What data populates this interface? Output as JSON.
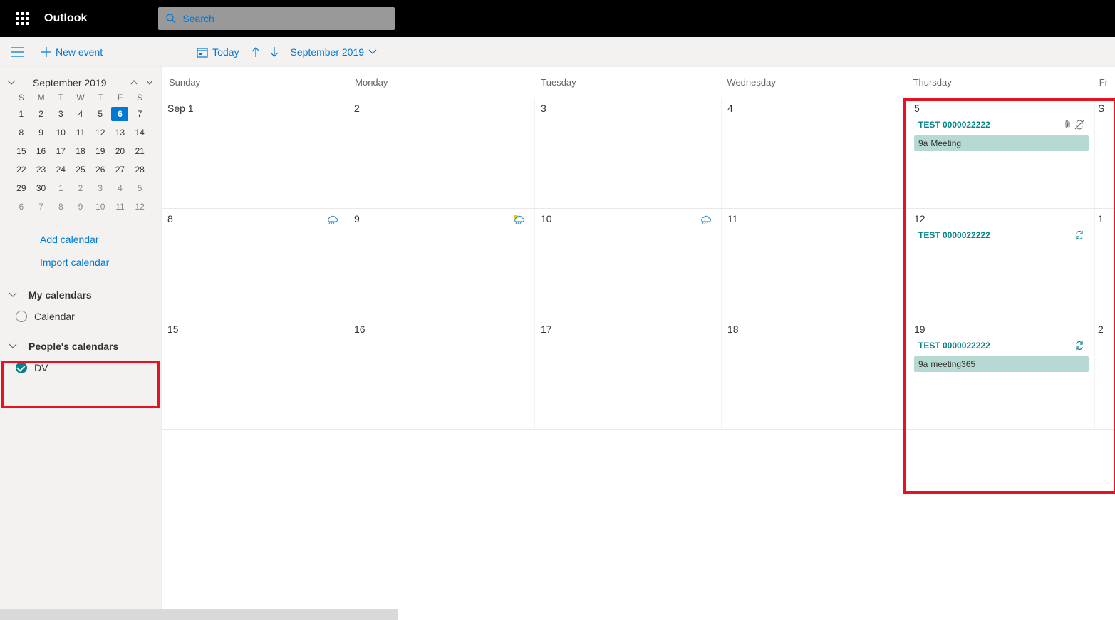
{
  "app_title": "Outlook",
  "search": {
    "placeholder": "Search"
  },
  "toolbar": {
    "new_event": "New event",
    "today": "Today",
    "month_label": "September 2019"
  },
  "mini_cal": {
    "title": "September 2019",
    "dow": [
      "S",
      "M",
      "T",
      "W",
      "T",
      "F",
      "S"
    ],
    "weeks": [
      [
        {
          "n": "1"
        },
        {
          "n": "2"
        },
        {
          "n": "3"
        },
        {
          "n": "4"
        },
        {
          "n": "5"
        },
        {
          "n": "6",
          "today": true
        },
        {
          "n": "7"
        }
      ],
      [
        {
          "n": "8"
        },
        {
          "n": "9"
        },
        {
          "n": "10"
        },
        {
          "n": "11"
        },
        {
          "n": "12"
        },
        {
          "n": "13"
        },
        {
          "n": "14"
        }
      ],
      [
        {
          "n": "15"
        },
        {
          "n": "16"
        },
        {
          "n": "17"
        },
        {
          "n": "18"
        },
        {
          "n": "19"
        },
        {
          "n": "20"
        },
        {
          "n": "21"
        }
      ],
      [
        {
          "n": "22"
        },
        {
          "n": "23"
        },
        {
          "n": "24"
        },
        {
          "n": "25"
        },
        {
          "n": "26"
        },
        {
          "n": "27"
        },
        {
          "n": "28"
        }
      ],
      [
        {
          "n": "29"
        },
        {
          "n": "30"
        },
        {
          "n": "1",
          "o": true
        },
        {
          "n": "2",
          "o": true
        },
        {
          "n": "3",
          "o": true
        },
        {
          "n": "4",
          "o": true
        },
        {
          "n": "5",
          "o": true
        }
      ],
      [
        {
          "n": "6",
          "o": true
        },
        {
          "n": "7",
          "o": true
        },
        {
          "n": "8",
          "o": true
        },
        {
          "n": "9",
          "o": true
        },
        {
          "n": "10",
          "o": true
        },
        {
          "n": "11",
          "o": true
        },
        {
          "n": "12",
          "o": true
        }
      ]
    ]
  },
  "side_links": {
    "add": "Add calendar",
    "import": "Import calendar"
  },
  "groups": {
    "my": {
      "label": "My calendars",
      "items": [
        {
          "label": "Calendar",
          "checked": false
        }
      ]
    },
    "people": {
      "label": "People's calendars",
      "items": [
        {
          "label": "DV",
          "checked": true
        }
      ]
    }
  },
  "columns": [
    "Sunday",
    "Monday",
    "Tuesday",
    "Wednesday",
    "Thursday",
    "Fr"
  ],
  "rows": [
    {
      "cells": [
        {
          "label": "Sep 1"
        },
        {
          "label": "2"
        },
        {
          "label": "3"
        },
        {
          "label": "4"
        },
        {
          "label": "5",
          "events": [
            {
              "type": "test",
              "text": "TEST 0000022222",
              "icons": [
                "attach",
                "norecur"
              ]
            },
            {
              "type": "filled",
              "prefix": "9a",
              "text": "Meeting"
            }
          ]
        },
        {
          "label": "S",
          "today": true
        }
      ]
    },
    {
      "cells": [
        {
          "label": "8",
          "weather": "rain-blue"
        },
        {
          "label": "9",
          "weather": "rain-yellow"
        },
        {
          "label": "10",
          "weather": "rain-blue"
        },
        {
          "label": "11"
        },
        {
          "label": "12",
          "events": [
            {
              "type": "test",
              "text": "TEST 0000022222",
              "icons": [
                "recur"
              ]
            }
          ]
        },
        {
          "label": "1"
        }
      ]
    },
    {
      "cells": [
        {
          "label": "15"
        },
        {
          "label": "16"
        },
        {
          "label": "17"
        },
        {
          "label": "18"
        },
        {
          "label": "19",
          "events": [
            {
              "type": "test",
              "text": "TEST 0000022222",
              "icons": [
                "recur"
              ]
            },
            {
              "type": "filled",
              "prefix": "9a",
              "text": "meeting365"
            }
          ]
        },
        {
          "label": "2"
        }
      ]
    }
  ]
}
